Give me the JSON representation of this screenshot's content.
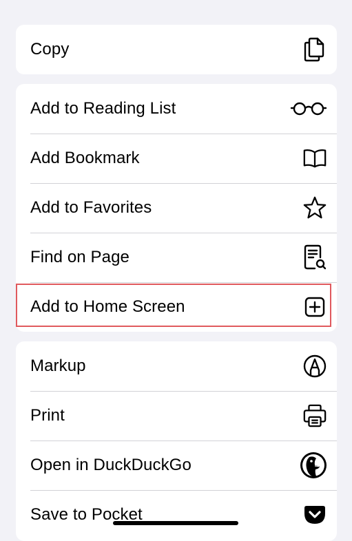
{
  "groups": [
    {
      "items": [
        {
          "label": "Copy",
          "icon": "copy-icon"
        }
      ]
    },
    {
      "items": [
        {
          "label": "Add to Reading List",
          "icon": "glasses-icon"
        },
        {
          "label": "Add Bookmark",
          "icon": "book-icon"
        },
        {
          "label": "Add to Favorites",
          "icon": "star-icon"
        },
        {
          "label": "Find on Page",
          "icon": "find-document-icon"
        },
        {
          "label": "Add to Home Screen",
          "icon": "plus-square-icon"
        }
      ]
    },
    {
      "items": [
        {
          "label": "Markup",
          "icon": "markup-pen-icon"
        },
        {
          "label": "Print",
          "icon": "printer-icon"
        },
        {
          "label": "Open in DuckDuckGo",
          "icon": "duckduckgo-icon"
        },
        {
          "label": "Save to Pocket",
          "icon": "pocket-icon"
        }
      ]
    }
  ],
  "highlight": {
    "color": "#e0595d",
    "target": "Add to Home Screen"
  }
}
